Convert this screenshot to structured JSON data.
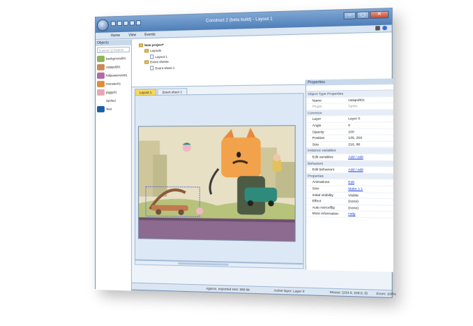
{
  "window": {
    "title": "Construct 2 (beta build) - Layout 1",
    "controls": [
      "–",
      "▢",
      "✕"
    ]
  },
  "ribbon": {
    "tabs": [
      "Home",
      "View",
      "Events"
    ],
    "icons": [
      {
        "name": "edit-icon",
        "color": "#555555"
      },
      {
        "name": "help-icon",
        "color": "#3a6fc4"
      }
    ]
  },
  "objects_panel": {
    "title": "Objects",
    "search_placeholder": "[Layout 1] Search",
    "items": [
      {
        "label": "background01",
        "icon": "background-thumb",
        "color": "#8fb35b"
      },
      {
        "label": "catapult01",
        "icon": "catapult-thumb",
        "color": "#c98a58"
      },
      {
        "label": "fullpowerrent01",
        "icon": "powerup-thumb",
        "color": "#b06aa8"
      },
      {
        "label": "monster01",
        "icon": "monster-thumb",
        "color": "#e08c3a"
      },
      {
        "label": "piggy01",
        "icon": "piggy-thumb",
        "color": "#e6a7b5"
      },
      {
        "label": "Sprite2",
        "icon": "sprite-thumb",
        "color": "#ffffff"
      },
      {
        "label": "Text",
        "icon": "text-thumb",
        "color": "#1b5ea8"
      }
    ]
  },
  "project_panel": {
    "root": "New project*",
    "items": [
      {
        "label": "Layouts",
        "type": "folder"
      },
      {
        "label": "Layout 1",
        "type": "sheet"
      },
      {
        "label": "Event sheets",
        "type": "folder"
      },
      {
        "label": "Event sheet 1",
        "type": "sheet"
      }
    ]
  },
  "doc_tabs": [
    {
      "label": "Layout 1",
      "active": true
    },
    {
      "label": "Event sheet 1",
      "active": false
    }
  ],
  "properties": {
    "title": "Properties",
    "rows": [
      {
        "kind": "section",
        "name": "Object Type Properties"
      },
      {
        "kind": "row",
        "name": "Name",
        "value": "catapult01"
      },
      {
        "kind": "row",
        "name": "Plugin",
        "value": "Sprite",
        "disabled": true
      },
      {
        "kind": "section",
        "name": "Common"
      },
      {
        "kind": "row",
        "name": "Layer",
        "value": "Layer 0"
      },
      {
        "kind": "row",
        "name": "Angle",
        "value": "0"
      },
      {
        "kind": "row",
        "name": "Opacity",
        "value": "100"
      },
      {
        "kind": "row",
        "name": "Position",
        "value": "135, 258"
      },
      {
        "kind": "row",
        "name": "Size",
        "value": "216, 88"
      },
      {
        "kind": "section",
        "name": "Instance variables"
      },
      {
        "kind": "row",
        "name": "Edit variables",
        "value": "Add / edit",
        "link": true
      },
      {
        "kind": "section",
        "name": "Behaviors"
      },
      {
        "kind": "row",
        "name": "Edit behaviors",
        "value": "Add / edit",
        "link": true
      },
      {
        "kind": "section",
        "name": "Properties"
      },
      {
        "kind": "row",
        "name": "Animations",
        "value": "Edit",
        "link": true
      },
      {
        "kind": "row",
        "name": "Size",
        "value": "Make 1:1",
        "link": true
      },
      {
        "kind": "row",
        "name": "Initial visibility",
        "value": "Visible"
      },
      {
        "kind": "row",
        "name": "Effect",
        "value": "(none)"
      },
      {
        "kind": "row",
        "name": "Auto mirror/flip",
        "value": "(none)"
      },
      {
        "kind": "row",
        "name": "More information",
        "value": "Help",
        "link": true
      }
    ]
  },
  "statusbar": {
    "download_size": "Approx. exported size: 968 kb",
    "active_layer": "Active layer: Layer 0",
    "mouse": "Mouse: (234.0, 229.0, 0)",
    "zoom": "Zoom: 100%"
  },
  "colors": {
    "accent": "#4f7fb8",
    "tab_active": "#f6d75c",
    "link": "#1a3fd6"
  }
}
